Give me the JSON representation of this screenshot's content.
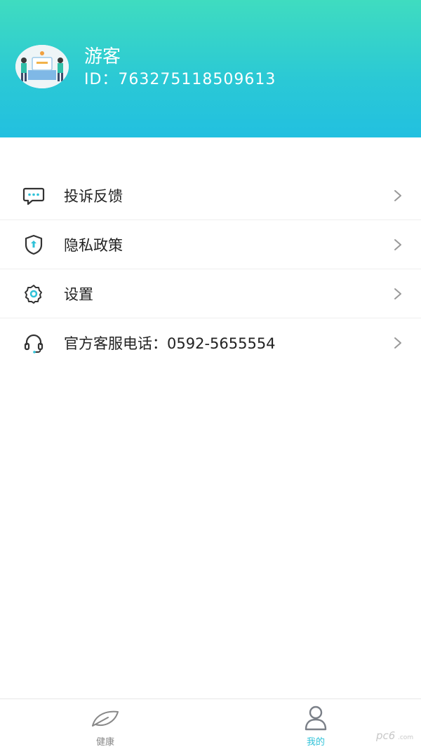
{
  "header": {
    "user_name": "游客",
    "user_id": "ID：763275118509613"
  },
  "menu": {
    "items": [
      {
        "label": "投诉反馈",
        "icon": "chat-bubble-icon"
      },
      {
        "label": "隐私政策",
        "icon": "shield-icon"
      },
      {
        "label": "设置",
        "icon": "gear-icon"
      },
      {
        "label": "官方客服电话：0592-5655554",
        "icon": "headset-icon"
      }
    ]
  },
  "tabbar": {
    "tabs": [
      {
        "label": "健康",
        "icon": "leaf-icon",
        "active": false
      },
      {
        "label": "我的",
        "icon": "person-icon",
        "active": true
      }
    ]
  },
  "watermark": {
    "text": "pc6.com"
  },
  "colors": {
    "header_gradient_start": "#3fdcc0",
    "header_gradient_end": "#22c0e0",
    "active_tab": "#2fc2d8",
    "icon_accent": "#2fc2d8"
  }
}
